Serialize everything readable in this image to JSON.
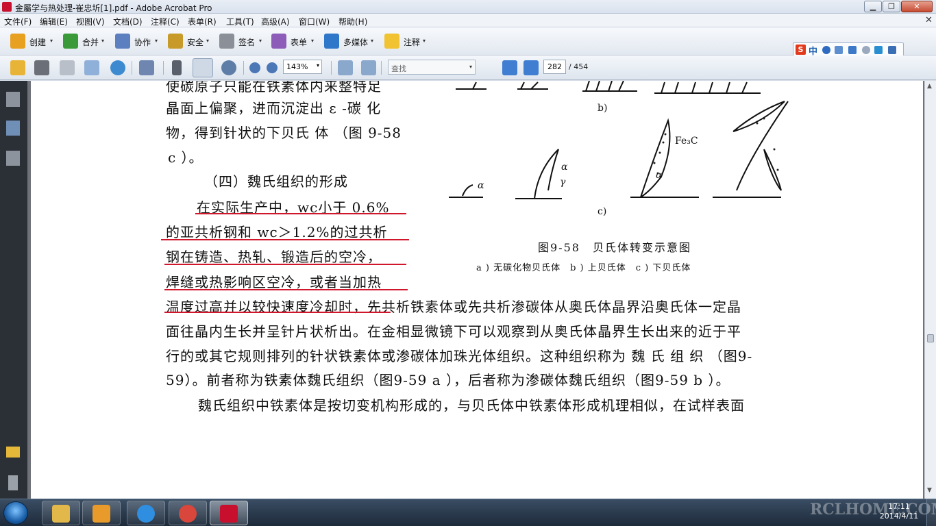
{
  "window": {
    "title": "金屬学与热处理-崔忠圻[1].pdf - Adobe Acrobat Pro",
    "minimize": "▁",
    "maximize": "❐",
    "close": "✕"
  },
  "menubar": {
    "items": [
      "文件(F)",
      "编辑(E)",
      "视图(V)",
      "文档(D)",
      "注释(C)",
      "表单(R)",
      "工具(T)",
      "高级(A)",
      "窗口(W)",
      "帮助(H)"
    ],
    "doc_close": "✕"
  },
  "tasks": [
    {
      "label": "创建",
      "icon": "create-icon",
      "color": "#e8a020"
    },
    {
      "label": "合并",
      "icon": "combine-icon",
      "color": "#3a9a3a"
    },
    {
      "label": "协作",
      "icon": "collaborate-icon",
      "color": "#5c7fc0"
    },
    {
      "label": "安全",
      "icon": "lock-icon",
      "color": "#c89a2a"
    },
    {
      "label": "签名",
      "icon": "pen-icon",
      "color": "#8a8f98"
    },
    {
      "label": "表单",
      "icon": "form-icon",
      "color": "#8c5cb8"
    },
    {
      "label": "多媒体",
      "icon": "multimedia-icon",
      "color": "#2f77c9"
    },
    {
      "label": "注释",
      "icon": "comment-icon",
      "color": "#f1c232"
    }
  ],
  "ime": {
    "logo": "S",
    "mode": "中"
  },
  "toolbar": {
    "zoom": "143%",
    "find_placeholder": "查找",
    "current_page": "282",
    "page_total": "/ 454"
  },
  "document": {
    "lines": [
      "使碳原子只能在铁素体内来整特足",
      "晶面上偏聚，进而沉淀出 ε -碳 化",
      "物，得到针状的下贝氏 体 （图 9-58",
      "c ）。",
      "（四）魏氏组织的形成",
      "在实际生产中，wc小于 0.6%",
      "的亚共析钢和 wc＞1.2%的过共析",
      "钢在铸造、热轧、锻造后的空冷，",
      "焊缝或热影响区空冷，或者当加热",
      "温度过高并以较快速度冷却时，先共析铁素体或先共析渗碳体从奥氏体晶界沿奥氏体一定晶",
      "面往晶内生长并呈针片状析出。在金相显微镜下可以观察到从奥氏体晶界生长出来的近于平",
      "行的或其它规则排列的针状铁素体或渗碳体加珠光体组织。这种组织称为 魏 氏 组 织 （图9-",
      "59）。前者称为铁素体魏氏组织（图9-59 a ），后者称为渗碳体魏氏组织（图9-59 b ）。",
      "魏氏组织中铁素体是按切变机构形成的，与贝氏体中铁素体形成机理相似，在试样表面"
    ],
    "figure": {
      "label_b": "b)",
      "label_c": "c)",
      "fe3c": "Fe₃C",
      "alpha": "α",
      "gamma": "γ",
      "caption": "图9-58　贝氏体转变示意图",
      "subcaption": "a ) 无碳化物贝氏体　b ) 上贝氏体　c ) 下贝氏体"
    }
  },
  "taskbar": {
    "time": "17:11",
    "date": "2014/4/11",
    "watermark": "RCLHOME.COM"
  }
}
